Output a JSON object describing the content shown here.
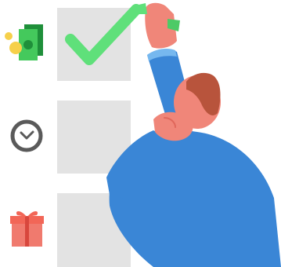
{
  "illustration": {
    "items": [
      {
        "icon": "money-icon",
        "checked": true
      },
      {
        "icon": "clock-icon",
        "checked": false
      },
      {
        "icon": "gift-icon",
        "checked": false
      }
    ],
    "colors": {
      "checkbox": "#e3e3e3",
      "checkmark": "#5fe07a",
      "money_green": "#44c95c",
      "coin_yellow": "#f6d04a",
      "clock_ring": "#5a5a5a",
      "gift_red": "#f07a6e",
      "shirt_blue": "#3a86d6",
      "skin": "#f08679",
      "hair": "#b8543c"
    }
  }
}
